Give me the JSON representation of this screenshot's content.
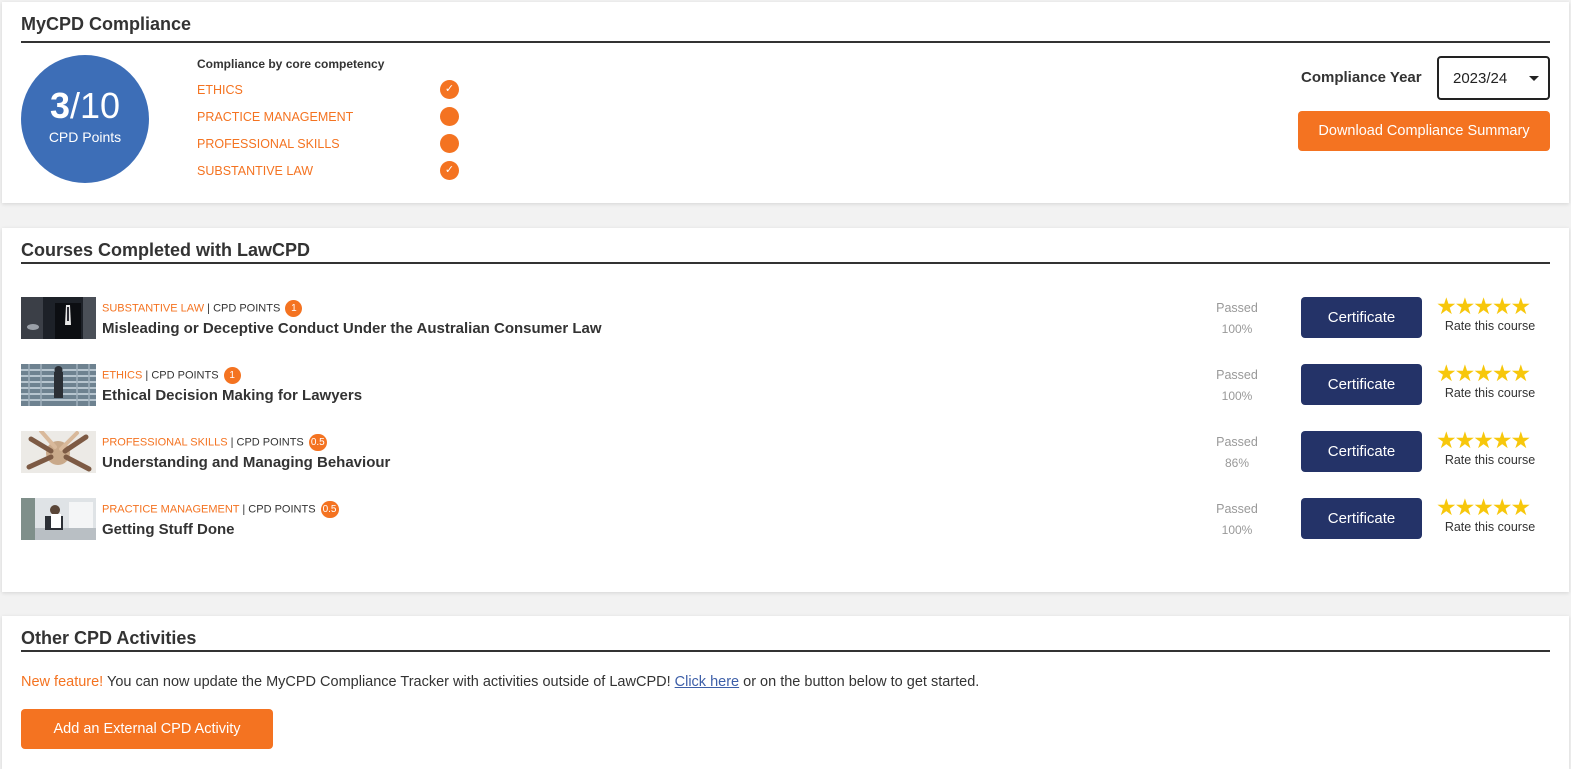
{
  "compliance": {
    "title": "MyCPD Compliance",
    "points_earned": "3",
    "points_total": "/10",
    "points_unit": "CPD Points",
    "competency_heading": "Compliance by core competency",
    "competencies": [
      {
        "label": "ETHICS",
        "met": true
      },
      {
        "label": "PRACTICE MANAGEMENT",
        "met": false
      },
      {
        "label": "PROFESSIONAL SKILLS",
        "met": false
      },
      {
        "label": "SUBSTANTIVE LAW",
        "met": true
      }
    ],
    "year_label": "Compliance Year",
    "year_value": "2023/24",
    "download_label": "Download Compliance Summary",
    "check_glyph": "✓"
  },
  "courses": {
    "title": "Courses Completed with LawCPD",
    "points_label": "CPD POINTS",
    "separator": "|",
    "items": [
      {
        "category": "SUBSTANTIVE LAW",
        "points": "1",
        "title": "Misleading or Deceptive Conduct Under the Australian Consumer Law",
        "status": "Passed",
        "score": "100%",
        "certificate_label": "Certificate",
        "stars": "★★★★★",
        "rate_label": "Rate this course",
        "thumb": "business-suit-thumbnail"
      },
      {
        "category": "ETHICS",
        "points": "1",
        "title": "Ethical Decision Making for Lawyers",
        "status": "Passed",
        "score": "100%",
        "certificate_label": "Certificate",
        "stars": "★★★★★",
        "rate_label": "Rate this course",
        "thumb": "maze-thumbnail"
      },
      {
        "category": "PROFESSIONAL SKILLS",
        "points": "0.5",
        "title": "Understanding and Managing Behaviour",
        "status": "Passed",
        "score": "86%",
        "certificate_label": "Certificate",
        "stars": "★★★★★",
        "rate_label": "Rate this course",
        "thumb": "team-hands-thumbnail"
      },
      {
        "category": "PRACTICE MANAGEMENT",
        "points": "0.5",
        "title": "Getting Stuff Done",
        "status": "Passed",
        "score": "100%",
        "certificate_label": "Certificate",
        "stars": "★★★★★",
        "rate_label": "Rate this course",
        "thumb": "office-desk-thumbnail"
      }
    ]
  },
  "other": {
    "title": "Other CPD Activities",
    "new_feature": "New feature!",
    "text_before_link": " You can now update the MyCPD Compliance Tracker with activities outside of LawCPD! ",
    "link_text": "Click here",
    "text_after_link": " or on the button below to get started.",
    "add_label": "Add an External CPD Activity"
  },
  "colors": {
    "accent": "#f47321",
    "navy": "#243368",
    "circle": "#3d6eb7",
    "star": "#f7c70b"
  }
}
